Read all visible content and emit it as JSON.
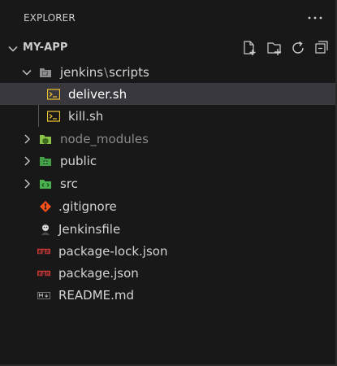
{
  "explorer": {
    "title": "EXPLORER",
    "more_icon": "more-ellipsis-icon",
    "more_label": "···"
  },
  "workspace": {
    "name": "MY-APP",
    "expanded": true,
    "actions": [
      {
        "name": "new-file-icon"
      },
      {
        "name": "new-folder-icon"
      },
      {
        "name": "refresh-icon"
      },
      {
        "name": "collapse-all-icon"
      }
    ]
  },
  "tree": {
    "jenkins_folder": {
      "label_part1": "jenkins",
      "separator": "\\",
      "label_part2": "scripts",
      "icon": "folder-icon",
      "expanded": true
    },
    "files": [
      {
        "label": "deliver.sh",
        "icon": "shell-terminal-icon",
        "selected": true
      },
      {
        "label": "kill.sh",
        "icon": "shell-terminal-icon",
        "selected": false
      }
    ],
    "folders": [
      {
        "label": "node_modules",
        "icon": "node-folder-icon",
        "muted": true
      },
      {
        "label": "public",
        "icon": "public-folder-icon",
        "muted": false
      },
      {
        "label": "src",
        "icon": "src-folder-icon",
        "muted": false
      }
    ],
    "root_files": [
      {
        "label": ".gitignore",
        "icon": "git-icon"
      },
      {
        "label": "Jenkinsfile",
        "icon": "jenkins-icon"
      },
      {
        "label": "package-lock.json",
        "icon": "npm-icon"
      },
      {
        "label": "package.json",
        "icon": "npm-icon"
      },
      {
        "label": "README.md",
        "icon": "markdown-icon"
      }
    ]
  },
  "colors": {
    "background": "#181818",
    "text": "#cccccc",
    "selection": "#37373d",
    "terminal_icon": "#f1c232",
    "node_green": "#8bc34a",
    "public_green": "#43a047",
    "src_green": "#4caf50",
    "git_red": "#f4511e",
    "npm_red": "#cb3837"
  }
}
